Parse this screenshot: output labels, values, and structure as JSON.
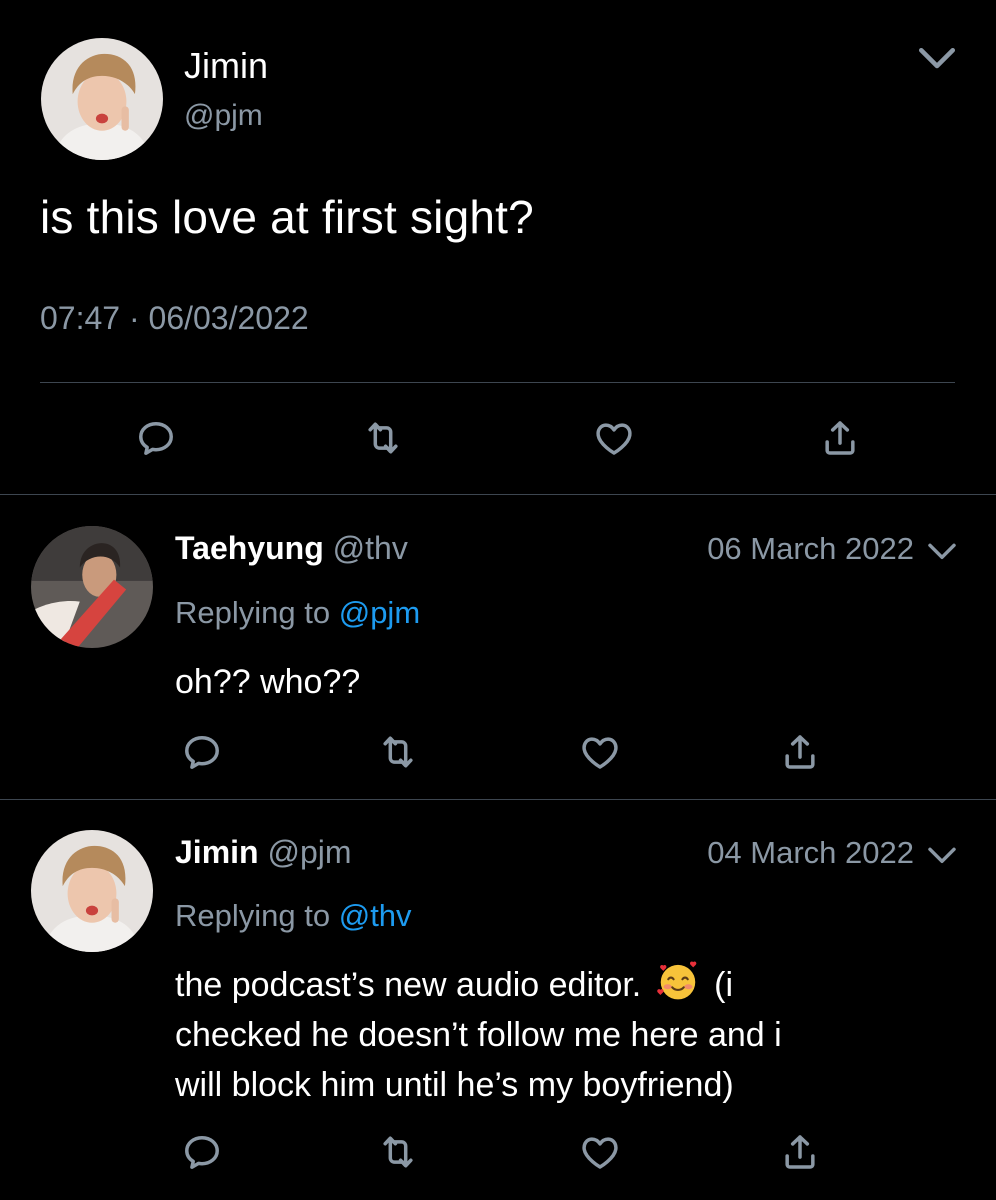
{
  "main_tweet": {
    "author_name": "Jimin",
    "author_handle": "@pjm",
    "text": "is this love at first sight?",
    "timestamp": "07:47 · 06/03/2022",
    "icons": [
      "reply-icon",
      "retweet-icon",
      "like-icon",
      "share-icon",
      "chevron-down-icon"
    ]
  },
  "replies": [
    {
      "author_name": "Taehyung",
      "author_handle": "@thv",
      "date": "06 March 2022",
      "replying_label": "Replying to",
      "replying_to": "@pjm",
      "text": "oh?? who??"
    },
    {
      "author_name": "Jimin",
      "author_handle": "@pjm",
      "date": "04 March 2022",
      "replying_label": "Replying to",
      "replying_to": "@thv",
      "text_before_emoji": "the podcast’s new audio editor.",
      "emoji": "smiling-face-with-hearts",
      "text_after_emoji": "(i",
      "text_line_2": "checked he doesn’t follow me here and i",
      "text_line_3": "will block him until he’s my boyfriend)"
    }
  ],
  "colors": {
    "background": "#000000",
    "primary_text": "#ffffff",
    "secondary_text": "#8b98a5",
    "link": "#1d9bf0",
    "divider": "#3d4650"
  }
}
